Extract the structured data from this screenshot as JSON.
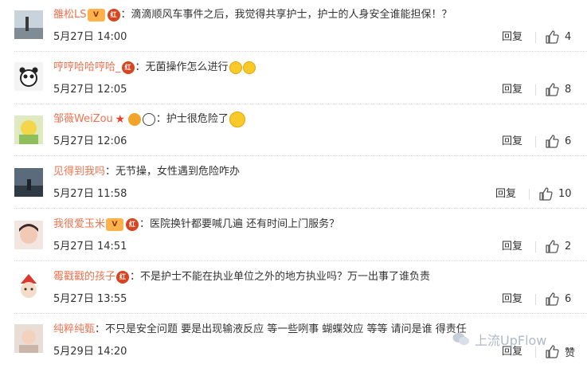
{
  "reply_label": "回复",
  "watermark_text": "上流UpFlow",
  "comments": [
    {
      "user": "雒松LS",
      "text": "：滴滴顺风车事件之后，我觉得共享护士，护士的人身安全谁能担保！？",
      "time": "5月27日 14:00",
      "likes": "4",
      "badges": [
        "vip-badge",
        "activity-badge"
      ]
    },
    {
      "user": "哼哼哈哈哼哈_",
      "text": "：无菌操作怎么进行",
      "time": "5月27日 12:05",
      "likes": "8",
      "badges": [
        "activity-badge"
      ],
      "emoji_after": 2
    },
    {
      "user": "邹薇WeiZou",
      "text": "：护士很危险了",
      "time": "5月27日 12:06",
      "likes": "6",
      "badges": [
        "star-badge",
        "fox-badge",
        "panda-badge"
      ],
      "emoji_after": 1
    },
    {
      "user": "见得到我吗",
      "text": "：无节操，女性遇到危险咋办",
      "time": "5月27日 11:58",
      "likes": "10",
      "badges": []
    },
    {
      "user": "我很爱玉米",
      "text": "：医院换针都要喊几遍 还有时间上门服务？",
      "time": "5月27日 14:51",
      "likes": "2",
      "badges": [
        "vip-badge",
        "activity-badge"
      ]
    },
    {
      "user": "霉戳戳的孩子",
      "text": "：不是护士不能在执业单位之外的地方执业吗？万一出事了谁负责",
      "time": "5月27日 13:55",
      "likes": "6",
      "badges": [
        "activity-badge"
      ]
    },
    {
      "user": "纯粹纯甄",
      "text": "：不只是安全问题   要是出现输液反应  等一些咧事   蝴蝶效应    等等    请问是谁 得责任",
      "time": "5月29日 14:20",
      "likes": "赞",
      "badges": []
    }
  ],
  "colors": {
    "username": "#eb7350",
    "text": "#333333",
    "badge_red": "#d6451f"
  }
}
